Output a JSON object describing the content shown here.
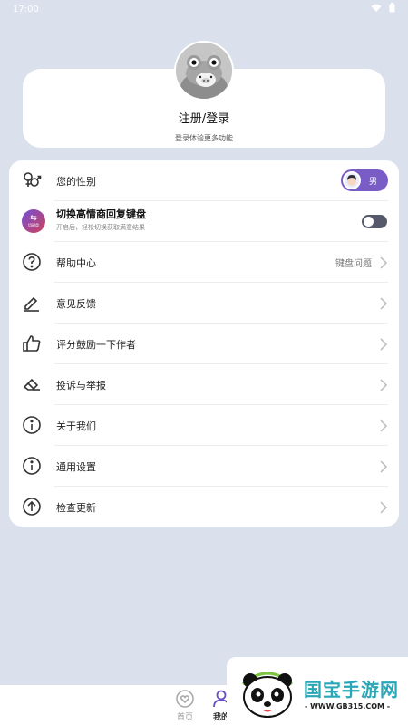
{
  "status": {
    "time": "17:00"
  },
  "profile": {
    "title": "注册/登录",
    "subtitle": "登录体验更多功能"
  },
  "menu": {
    "gender": {
      "label": "您的性别",
      "value": "男"
    },
    "keyboard": {
      "title": "切换高情商回复键盘",
      "subtitle": "开启后，轻松切换获取满意结果",
      "icon_text": "切键盘",
      "enabled": false
    },
    "help": {
      "label": "帮助中心",
      "right_text": "键盘问题"
    },
    "feedback": {
      "label": "意见反馈"
    },
    "rate": {
      "label": "评分鼓励一下作者"
    },
    "report": {
      "label": "投诉与举报"
    },
    "about": {
      "label": "关于我们"
    },
    "settings": {
      "label": "通用设置"
    },
    "update": {
      "label": "检查更新"
    }
  },
  "tabbar": {
    "home": {
      "label": "首页"
    },
    "me": {
      "label": "我的"
    }
  },
  "watermark": {
    "name": "国宝手游网",
    "url": "- WWW.GB315.COM -"
  },
  "colors": {
    "background": "#dbe1ec",
    "accent": "#7a5cc6",
    "switch_off": "#55596a",
    "watermark": "#2aa7b6"
  }
}
